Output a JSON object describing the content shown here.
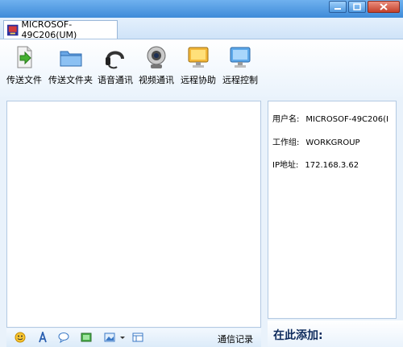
{
  "window": {
    "controls": [
      "minimize-icon",
      "maximize-icon",
      "close-icon"
    ]
  },
  "tab": {
    "label": "MICROSOF-49C206(UM)"
  },
  "toolbar": {
    "items": [
      {
        "label": "传送文件",
        "icon": "send-file-icon"
      },
      {
        "label": "传送文件夹",
        "icon": "send-folder-icon"
      },
      {
        "label": "语音通讯",
        "icon": "headset-icon"
      },
      {
        "label": "视频通讯",
        "icon": "webcam-icon"
      },
      {
        "label": "远程协助",
        "icon": "remote-assist-icon"
      },
      {
        "label": "远程控制",
        "icon": "remote-control-icon"
      }
    ]
  },
  "bottom_bar": {
    "icons": [
      "emoticon-icon",
      "font-icon",
      "chat-bubble-icon",
      "screenshot-icon",
      "image-icon",
      "dropdown-icon",
      "layout-icon"
    ],
    "chat_record": "通信记录"
  },
  "info": {
    "username_label": "用户名:",
    "username_value": "MICROSOF-49C206(I",
    "workgroup_label": "工作组:",
    "workgroup_value": "WORKGROUP",
    "ip_label": "IP地址:",
    "ip_value": "172.168.3.62"
  },
  "add_panel": {
    "title": "在此添加:"
  },
  "colors": {
    "titlebar": "#4f97df",
    "accent": "#0d2a5c",
    "panel_border": "#b3c9e2"
  }
}
